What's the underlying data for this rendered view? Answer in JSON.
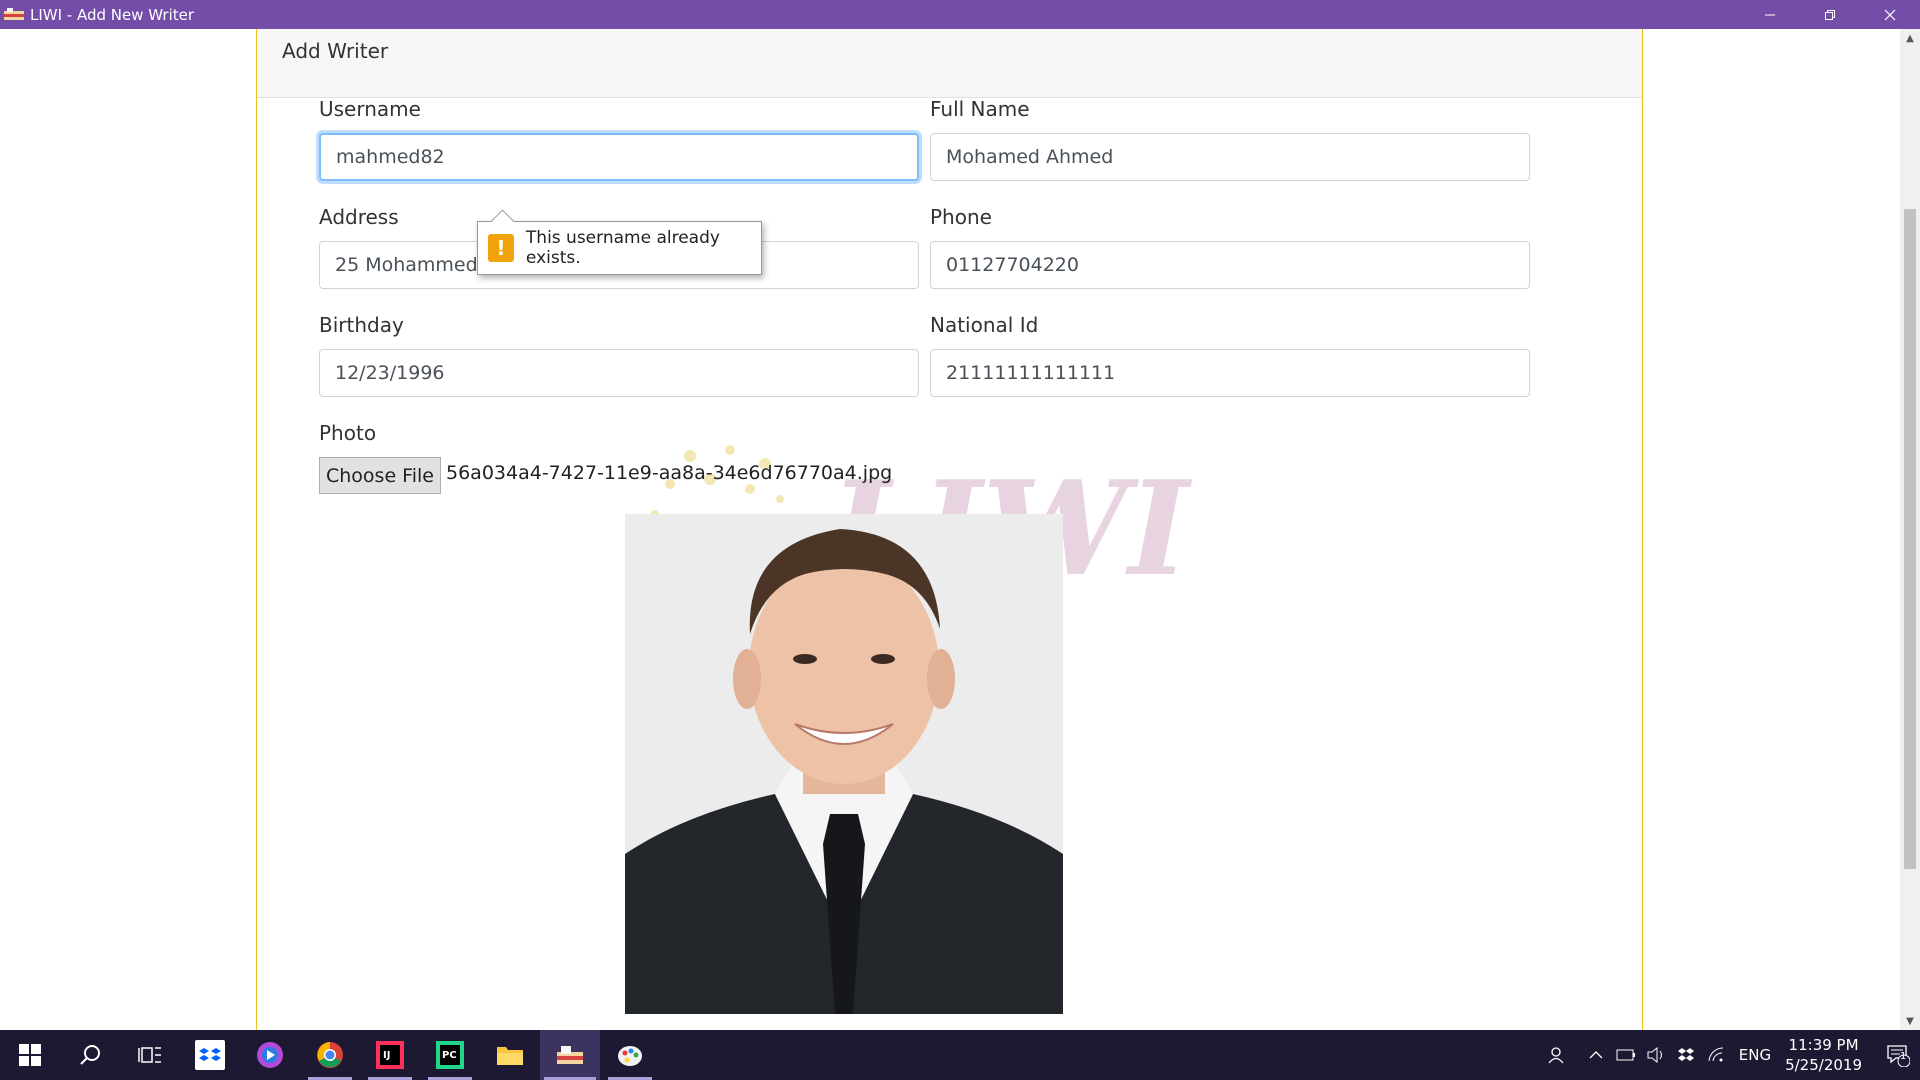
{
  "window": {
    "title": "LIWI - Add New Writer"
  },
  "card": {
    "header": "Add Writer"
  },
  "form": {
    "username": {
      "label": "Username",
      "value": "mahmed82"
    },
    "full_name": {
      "label": "Full Name",
      "value": "Mohamed Ahmed"
    },
    "address": {
      "label": "Address",
      "value": "25 Mohammed Fathi St."
    },
    "phone": {
      "label": "Phone",
      "value": "01127704220"
    },
    "birthday": {
      "label": "Birthday",
      "value": "12/23/1996"
    },
    "national_id": {
      "label": "National Id",
      "value": "21111111111111"
    },
    "photo": {
      "label": "Photo",
      "button": "Choose File",
      "filename": "56a034a4-7427-11e9-aa8a-34e6d76770a4.jpg"
    }
  },
  "validation": {
    "message": "This username already exists.",
    "icon": "warning-icon"
  },
  "watermark": {
    "text": "LIWI"
  },
  "taskbar": {
    "apps": [
      "start",
      "search",
      "task-view",
      "dropbox",
      "media",
      "chrome",
      "intellij",
      "pycharm",
      "file-explorer",
      "liwi-app",
      "paint"
    ],
    "tray": {
      "language": "ENG",
      "time": "11:39 PM",
      "date": "5/25/2019",
      "notifications": "1"
    }
  },
  "colors": {
    "titlebar": "#744da9",
    "taskbar": "#1e1933",
    "card_border": "#e8c21c",
    "focus": "#80bdff",
    "warning": "#f0a30a"
  }
}
